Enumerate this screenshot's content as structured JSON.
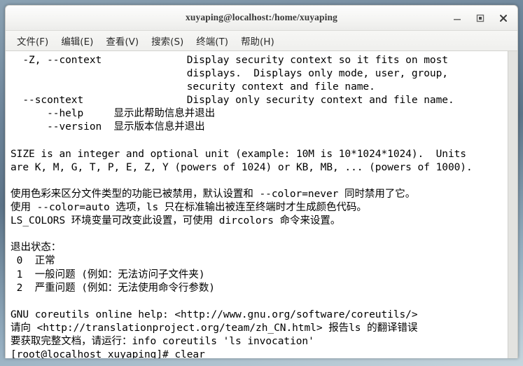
{
  "window": {
    "title": "xuyaping@localhost:/home/xuyaping",
    "controls": [
      {
        "name": "minimize-button",
        "glyph": "minimize-icon",
        "label": "–"
      },
      {
        "name": "maximize-button",
        "glyph": "maximize-icon",
        "label": "□"
      },
      {
        "name": "close-button",
        "glyph": "close-icon",
        "label": "✕"
      }
    ]
  },
  "menubar": {
    "items": [
      {
        "label": "文件(F)",
        "name": "menu-file"
      },
      {
        "label": "编辑(E)",
        "name": "menu-edit"
      },
      {
        "label": "查看(V)",
        "name": "menu-view"
      },
      {
        "label": "搜索(S)",
        "name": "menu-search"
      },
      {
        "label": "终端(T)",
        "name": "menu-terminal"
      },
      {
        "label": "帮助(H)",
        "name": "menu-help"
      }
    ]
  },
  "terminal": {
    "colors": {
      "background": "#ffffff",
      "foreground": "#000000",
      "titlebar": "#f4f4f2",
      "desktop": "#6d8499"
    },
    "prompt": "[root@localhost xuyaping]# ",
    "last_command": "clear",
    "lines": [
      "  -Z, --context              Display security context so it fits on most",
      "                             displays.  Displays only mode, user, group,",
      "                             security context and file name.",
      "  --scontext                 Display only security context and file name.",
      "      --help     显示此帮助信息并退出",
      "      --version  显示版本信息并退出",
      "",
      "SIZE is an integer and optional unit (example: 10M is 10*1024*1024).  Units",
      "are K, M, G, T, P, E, Z, Y (powers of 1024) or KB, MB, ... (powers of 1000).",
      "",
      "使用色彩来区分文件类型的功能已被禁用，默认设置和 --color=never 同时禁用了它。",
      "使用 --color=auto 选项，ls 只在标准输出被连至终端时才生成颜色代码。",
      "LS_COLORS 环境变量可改变此设置，可使用 dircolors 命令来设置。",
      "",
      "退出状态：",
      " 0  正常",
      " 1  一般问题 (例如：无法访问子文件夹)",
      " 2  严重问题 (例如：无法使用命令行参数)",
      "",
      "GNU coreutils online help: <http://www.gnu.org/software/coreutils/>",
      "请向 <http://translationproject.org/team/zh_CN.html> 报告ls 的翻译错误",
      "要获取完整文档，请运行：info coreutils 'ls invocation'",
      "[root@localhost xuyaping]# clear"
    ]
  }
}
